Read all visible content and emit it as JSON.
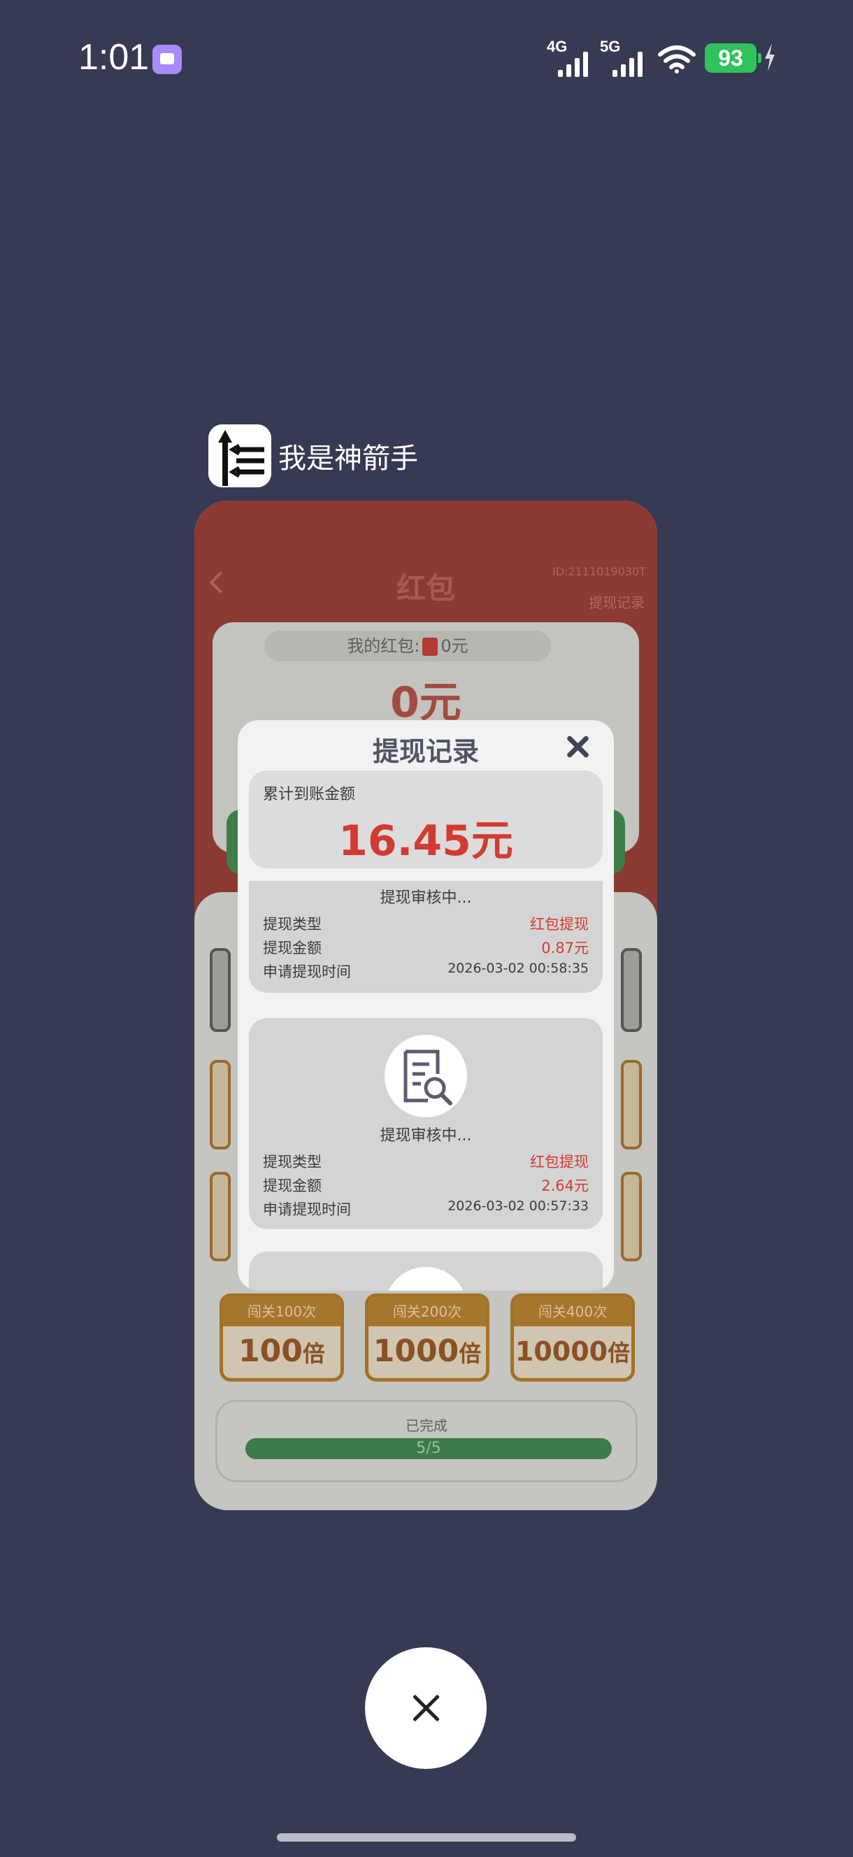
{
  "status_bar": {
    "time": "1:01",
    "net1": "4G",
    "net2": "5G",
    "battery": "93"
  },
  "app": {
    "name": "我是神箭手"
  },
  "card": {
    "title": "红包",
    "small_top": "ID:2111019030T",
    "small_link": "提现记录",
    "pill_label": "我的红包:",
    "pill_value": "0元",
    "big_zero": "0元",
    "multipliers": [
      {
        "level": "闯关100次",
        "value": "100",
        "unit": "倍"
      },
      {
        "level": "闯关200次",
        "value": "1000",
        "unit": "倍"
      },
      {
        "level": "闯关400次",
        "value": "10000",
        "unit": "倍"
      }
    ],
    "done_label": "已完成",
    "done_progress": "5/5"
  },
  "modal": {
    "title": "提现记录",
    "total_label": "累计到账金额",
    "total_value": "16.45元",
    "records": [
      {
        "status": "提现审核中...",
        "type_label": "提现类型",
        "type_value": "红包提现",
        "amount_label": "提现金额",
        "amount_value": "0.87元",
        "time_label": "申请提现时间",
        "time_value": "2026-03-02 00:58:35"
      },
      {
        "status": "提现审核中...",
        "type_label": "提现类型",
        "type_value": "红包提现",
        "amount_label": "提现金额",
        "amount_value": "2.64元",
        "time_label": "申请提现时间",
        "time_value": "2026-03-02 00:57:33"
      }
    ]
  },
  "colors": {
    "background": "#363a53",
    "accent_red": "#d23b32",
    "battery_green": "#31c25b"
  }
}
